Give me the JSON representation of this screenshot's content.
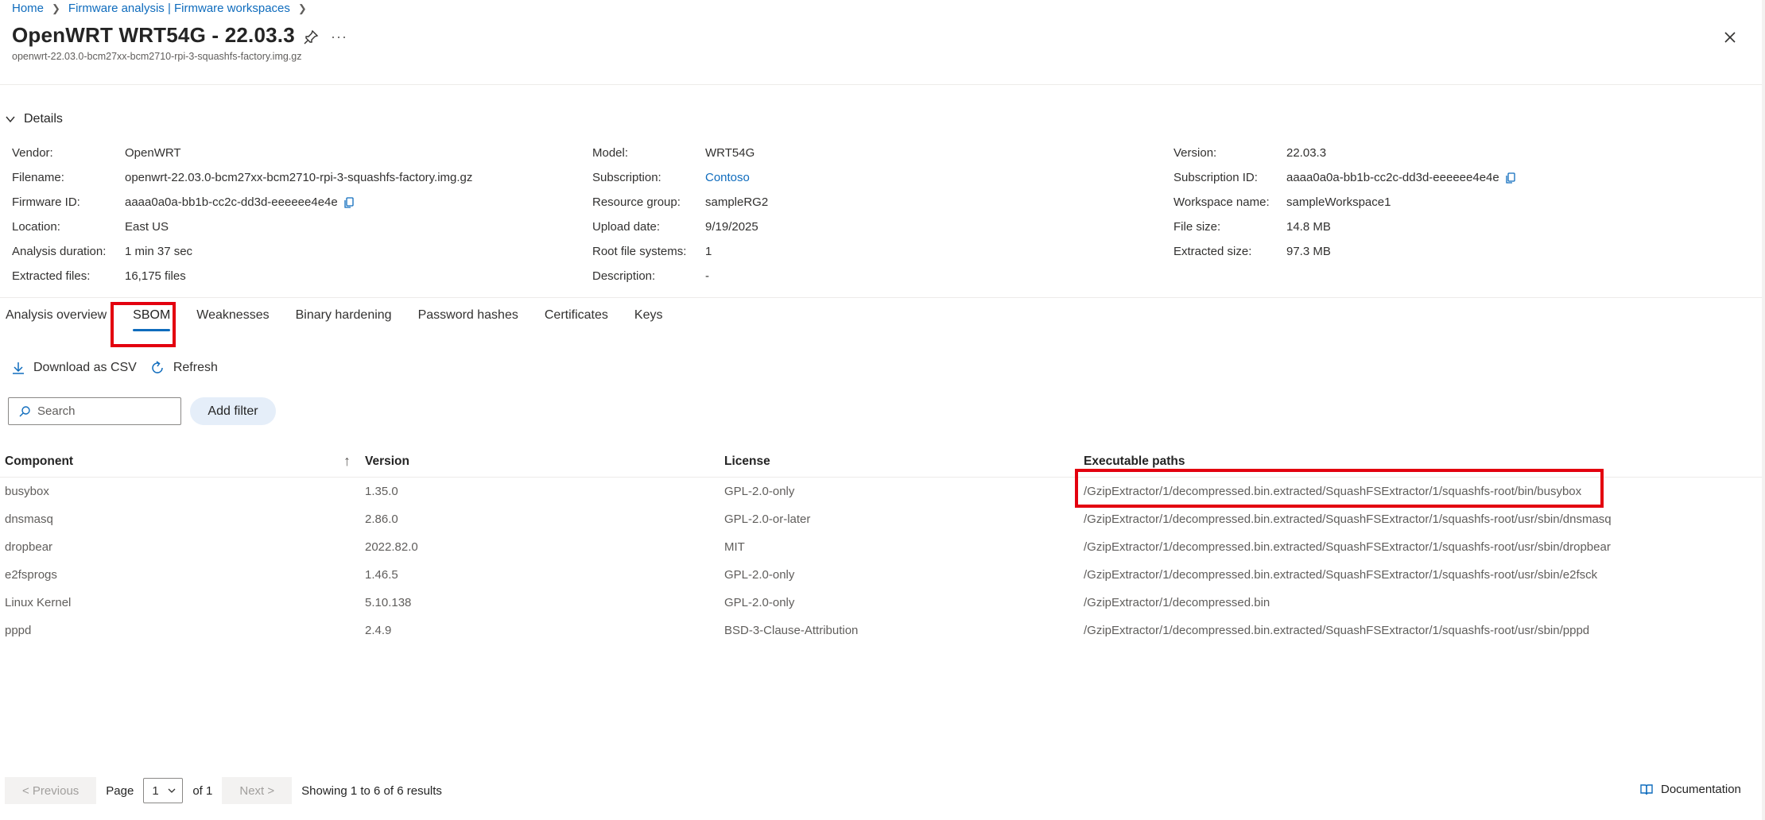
{
  "breadcrumb": [
    "Home",
    "Firmware analysis | Firmware workspaces"
  ],
  "header": {
    "title": "OpenWRT WRT54G - 22.03.3",
    "subtitle": "openwrt-22.03.0-bcm27xx-bcm2710-rpi-3-squashfs-factory.img.gz",
    "more": "···"
  },
  "details": {
    "label": "Details",
    "col1": [
      {
        "k": "Vendor:",
        "v": "OpenWRT"
      },
      {
        "k": "Filename:",
        "v": "openwrt-22.03.0-bcm27xx-bcm2710-rpi-3-squashfs-factory.img.gz"
      },
      {
        "k": "Firmware ID:",
        "v": "aaaa0a0a-bb1b-cc2c-dd3d-eeeeee4e4e"
      },
      {
        "k": "Location:",
        "v": "East US"
      },
      {
        "k": "Analysis duration:",
        "v": "1 min 37 sec"
      },
      {
        "k": "Extracted files:",
        "v": "16,175 files"
      }
    ],
    "col2": [
      {
        "k": "Model:",
        "v": "WRT54G"
      },
      {
        "k": "Subscription:",
        "v": "Contoso"
      },
      {
        "k": "Resource group:",
        "v": "sampleRG2"
      },
      {
        "k": "Upload date:",
        "v": "9/19/2025"
      },
      {
        "k": "Root file systems:",
        "v": "1"
      },
      {
        "k": "Description:",
        "v": "-"
      }
    ],
    "col3": [
      {
        "k": "Version:",
        "v": "22.03.3"
      },
      {
        "k": "Subscription ID:",
        "v": "aaaa0a0a-bb1b-cc2c-dd3d-eeeeee4e4e"
      },
      {
        "k": "Workspace name:",
        "v": "sampleWorkspace1"
      },
      {
        "k": "File size:",
        "v": "14.8 MB"
      },
      {
        "k": "Extracted size:",
        "v": "97.3 MB"
      }
    ]
  },
  "tabs": [
    "Analysis overview",
    "SBOM",
    "Weaknesses",
    "Binary hardening",
    "Password hashes",
    "Certificates",
    "Keys"
  ],
  "active_tab": "SBOM",
  "toolbar": {
    "download": "Download as CSV",
    "refresh": "Refresh"
  },
  "search": {
    "placeholder": "Search"
  },
  "add_filter": "Add filter",
  "table": {
    "headers": [
      "Component",
      "Version",
      "License",
      "Executable paths"
    ],
    "rows": [
      [
        "busybox",
        "1.35.0",
        "GPL-2.0-only",
        "/GzipExtractor/1/decompressed.bin.extracted/SquashFSExtractor/1/squashfs-root/bin/busybox"
      ],
      [
        "dnsmasq",
        "2.86.0",
        "GPL-2.0-or-later",
        "/GzipExtractor/1/decompressed.bin.extracted/SquashFSExtractor/1/squashfs-root/usr/sbin/dnsmasq"
      ],
      [
        "dropbear",
        "2022.82.0",
        "MIT",
        "/GzipExtractor/1/decompressed.bin.extracted/SquashFSExtractor/1/squashfs-root/usr/sbin/dropbear"
      ],
      [
        "e2fsprogs",
        "1.46.5",
        "GPL-2.0-only",
        "/GzipExtractor/1/decompressed.bin.extracted/SquashFSExtractor/1/squashfs-root/usr/sbin/e2fsck"
      ],
      [
        "Linux Kernel",
        "5.10.138",
        "GPL-2.0-only",
        "/GzipExtractor/1/decompressed.bin"
      ],
      [
        "pppd",
        "2.4.9",
        "BSD-3-Clause-Attribution",
        "/GzipExtractor/1/decompressed.bin.extracted/SquashFSExtractor/1/squashfs-root/usr/sbin/pppd"
      ]
    ]
  },
  "pager": {
    "previous": "< Previous",
    "page_label": "Page",
    "page_value": "1",
    "of": "of 1",
    "next": "Next >",
    "results": "Showing 1 to 6 of 6 results"
  },
  "documentation": "Documentation",
  "colors": {
    "accent": "#0f6cbd",
    "highlight": "#e3000f"
  }
}
